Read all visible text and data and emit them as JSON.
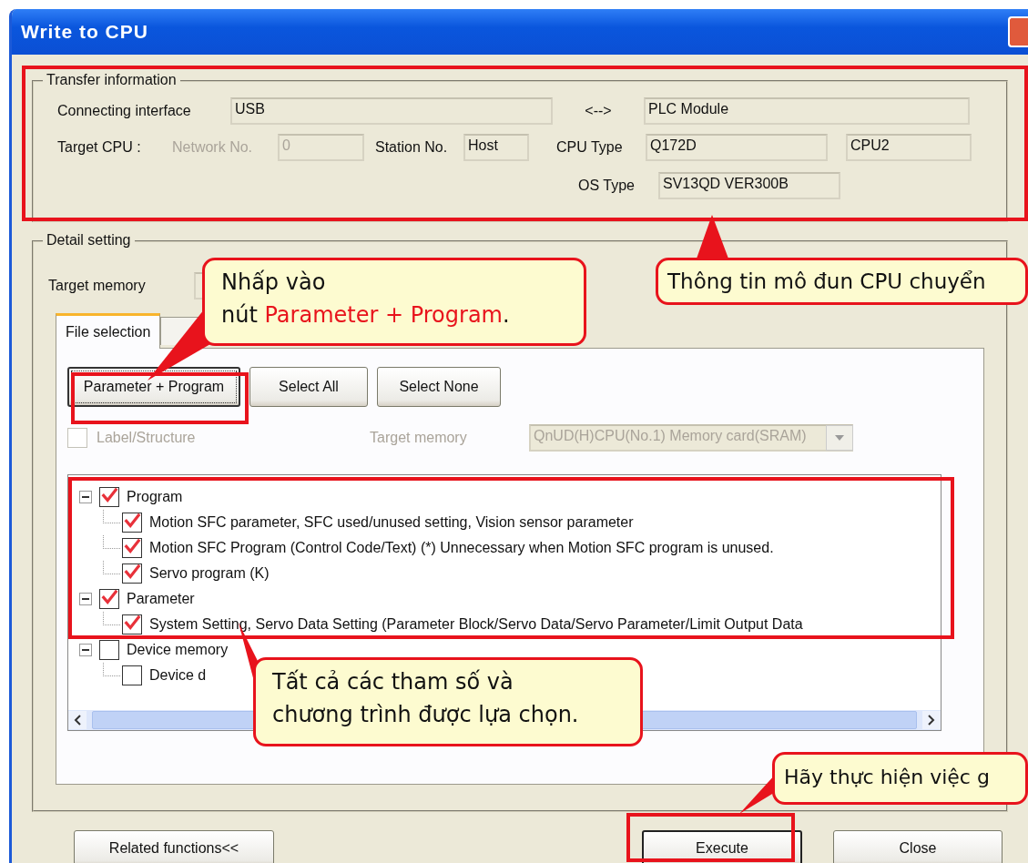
{
  "window": {
    "title": "Write to CPU"
  },
  "transfer_information": {
    "legend": "Transfer information",
    "connecting_interface": {
      "label": "Connecting interface",
      "value": "USB"
    },
    "arrow": "<-->",
    "module": "PLC Module",
    "target_cpu": {
      "label": "Target CPU :"
    },
    "network_no": {
      "label": "Network No.",
      "value": "0",
      "disabled": true
    },
    "station_no": {
      "label": "Station No.",
      "value": "Host",
      "disabled": false
    },
    "cpu_type": {
      "label": "CPU Type",
      "value": "Q172D",
      "extra": "CPU2"
    },
    "os_type": {
      "label": "OS Type",
      "value": "SV13QD VER300B"
    }
  },
  "detail_setting": {
    "legend": "Detail setting",
    "target_memory_label": "Target memory",
    "tabs": [
      {
        "label": "File selection",
        "selected": true
      },
      {
        "selected": false
      }
    ],
    "buttons": [
      {
        "label": "Parameter + Program",
        "focused": true
      },
      {
        "label": "Select All",
        "focused": false
      },
      {
        "label": "Select None",
        "focused": false
      }
    ],
    "label_structure": {
      "label": "Label/Structure",
      "checked": false,
      "disabled": true
    },
    "target_memory": {
      "label": "Target memory",
      "value": "QnUD(H)CPU(No.1) Memory card(SRAM)",
      "disabled": true
    },
    "tree": [
      {
        "label": "Program",
        "checked": true,
        "expanded": true,
        "children": [
          {
            "label": "Motion SFC parameter, SFC used/unused setting, Vision sensor parameter",
            "checked": true
          },
          {
            "label": "Motion SFC Program (Control Code/Text)  (*) Unnecessary when Motion SFC program is unused.",
            "checked": true
          },
          {
            "label": "Servo program (K)",
            "checked": true
          }
        ]
      },
      {
        "label": "Parameter",
        "checked": true,
        "expanded": true,
        "children": [
          {
            "label": "System Setting, Servo Data Setting (Parameter Block/Servo Data/Servo Parameter/Limit Output Data",
            "checked": true
          }
        ]
      },
      {
        "label": "Device memory",
        "checked": false,
        "expanded": true,
        "children": [
          {
            "label": "Device d",
            "checked": false
          }
        ]
      }
    ]
  },
  "footer_buttons": [
    {
      "label": "Related functions<<",
      "default": false
    },
    {
      "label": "Execute",
      "default": true
    },
    {
      "label": "Close",
      "default": false
    }
  ],
  "callouts": [
    {
      "parts": [
        {
          "text": "Nhấp vào\nnút ",
          "emphasis": false
        },
        {
          "text": "Parameter + Program",
          "emphasis": true
        },
        {
          "text": ".",
          "emphasis": false
        }
      ]
    },
    {
      "parts": [
        {
          "text": "Thông tin mô đun CPU chuyển",
          "emphasis": false
        }
      ]
    },
    {
      "parts": [
        {
          "text": "Tất cả các tham số và\nchương trình được lựa chọn.",
          "emphasis": false
        }
      ]
    },
    {
      "parts": [
        {
          "text": "Hãy thực hiện việc g",
          "emphasis": false
        }
      ]
    }
  ]
}
